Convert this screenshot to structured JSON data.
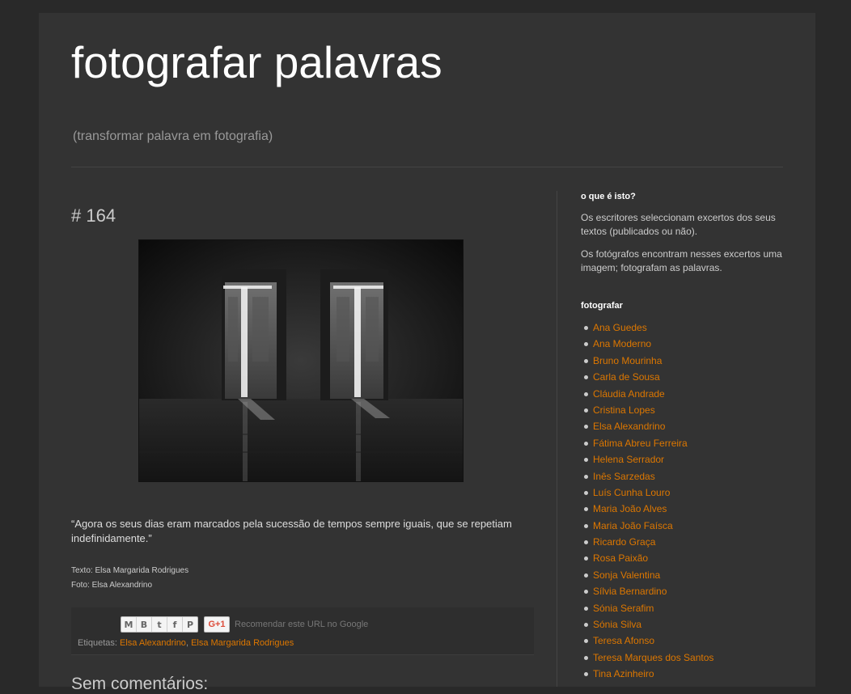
{
  "header": {
    "title": "fotografar palavras",
    "description": "(transformar palavra em fotografia)"
  },
  "post": {
    "title": "# 164",
    "quote": "“Agora os seus dias eram marcados pela sucessão de tempos sempre iguais, que se repetiam indefinidamente.”",
    "credit_text": "Texto: Elsa Margarida Rodrigues",
    "credit_photo": "Foto: Elsa Alexandrino",
    "share": {
      "buttons": [
        "email-icon",
        "blogger-icon",
        "twitter-icon",
        "facebook-icon",
        "pinterest-icon"
      ],
      "gplus_label": "G+1",
      "recommend_text": "Recomendar este URL no Google"
    },
    "labels_prefix": "Etiquetas:",
    "labels": [
      "Elsa Alexandrino",
      "Elsa Margarida Rodrigues"
    ],
    "labels_sep": ", "
  },
  "comments": {
    "heading": "Sem comentários:"
  },
  "sidebar": {
    "about": {
      "title": "o que é isto?",
      "p1": "Os escritores seleccionam excertos dos seus textos (publicados ou não).",
      "p2": "Os fotógrafos encontram nesses excertos uma imagem; fotografam as palavras."
    },
    "photographers": {
      "title": "fotografar",
      "items": [
        "Ana Guedes",
        "Ana Moderno",
        "Bruno Mourinha",
        "Carla de Sousa",
        "Cláudia Andrade",
        "Cristina Lopes",
        "Elsa Alexandrino",
        "Fátima Abreu Ferreira",
        "Helena Serrador",
        "Inês Sarzedas",
        "Luís Cunha Louro",
        "Maria João Alves",
        "Maria João Faísca",
        "Ricardo Graça",
        "Rosa Paixão",
        "Sonja Valentina",
        "Sílvia Bernardino",
        "Sónia Serafim",
        "Sónia Silva",
        "Teresa Afonso",
        "Teresa Marques dos Santos",
        "Tina Azinheiro"
      ]
    }
  },
  "colors": {
    "background": "#292929",
    "content": "#333333",
    "link": "#dd7700",
    "title": "#ffffff"
  }
}
